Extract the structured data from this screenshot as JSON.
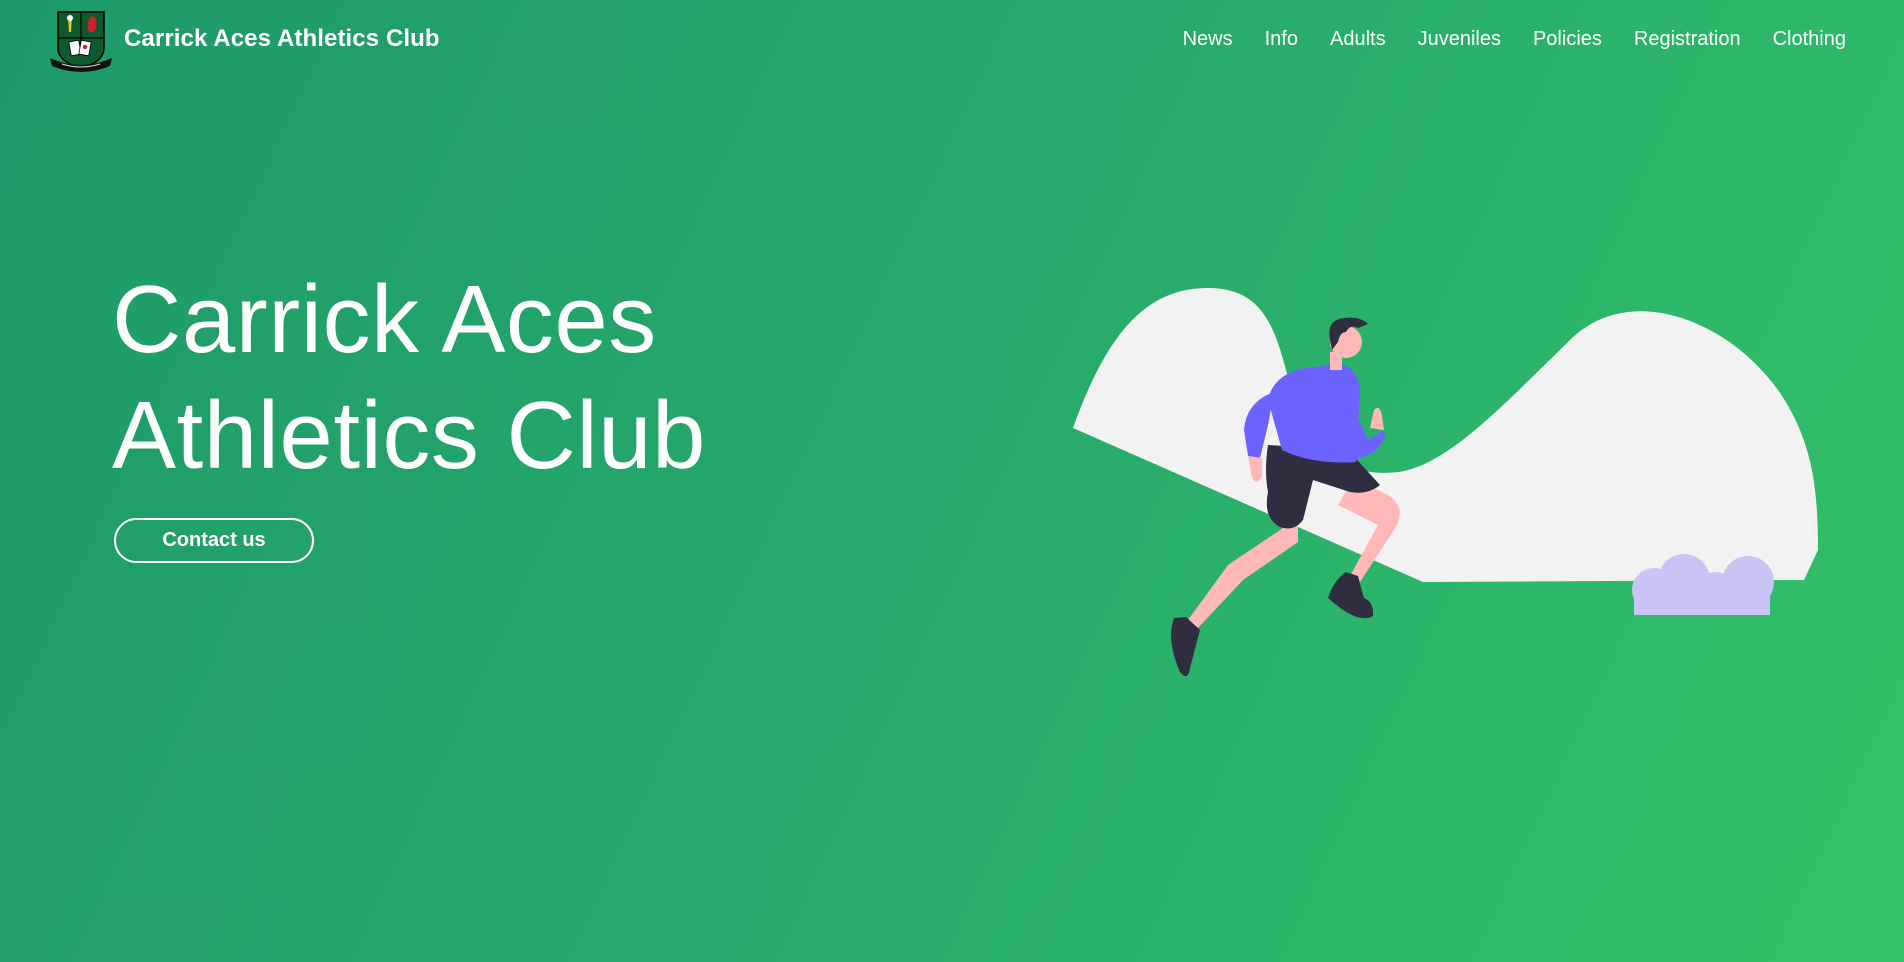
{
  "site": {
    "brand_name": "Carrick Aces Athletics Club",
    "logo_icon": "club-crest-icon"
  },
  "nav": {
    "items": [
      {
        "label": "News"
      },
      {
        "label": "Info"
      },
      {
        "label": "Adults"
      },
      {
        "label": "Juveniles"
      },
      {
        "label": "Policies"
      },
      {
        "label": "Registration"
      },
      {
        "label": "Clothing"
      }
    ]
  },
  "hero": {
    "title_line1": "Carrick Aces",
    "title_line2": "Athletics Club",
    "cta_label": "Contact us",
    "illustration_icon": "runner-illustration"
  },
  "colors": {
    "gradient_start": "#1e9a6a",
    "gradient_end": "#33c268",
    "text": "#ffffff",
    "hill": "#f2f2f2",
    "shirt": "#6c63ff",
    "shorts": "#2f2e41",
    "skin": "#ffb8b8",
    "bush": "#c9c4f5"
  }
}
